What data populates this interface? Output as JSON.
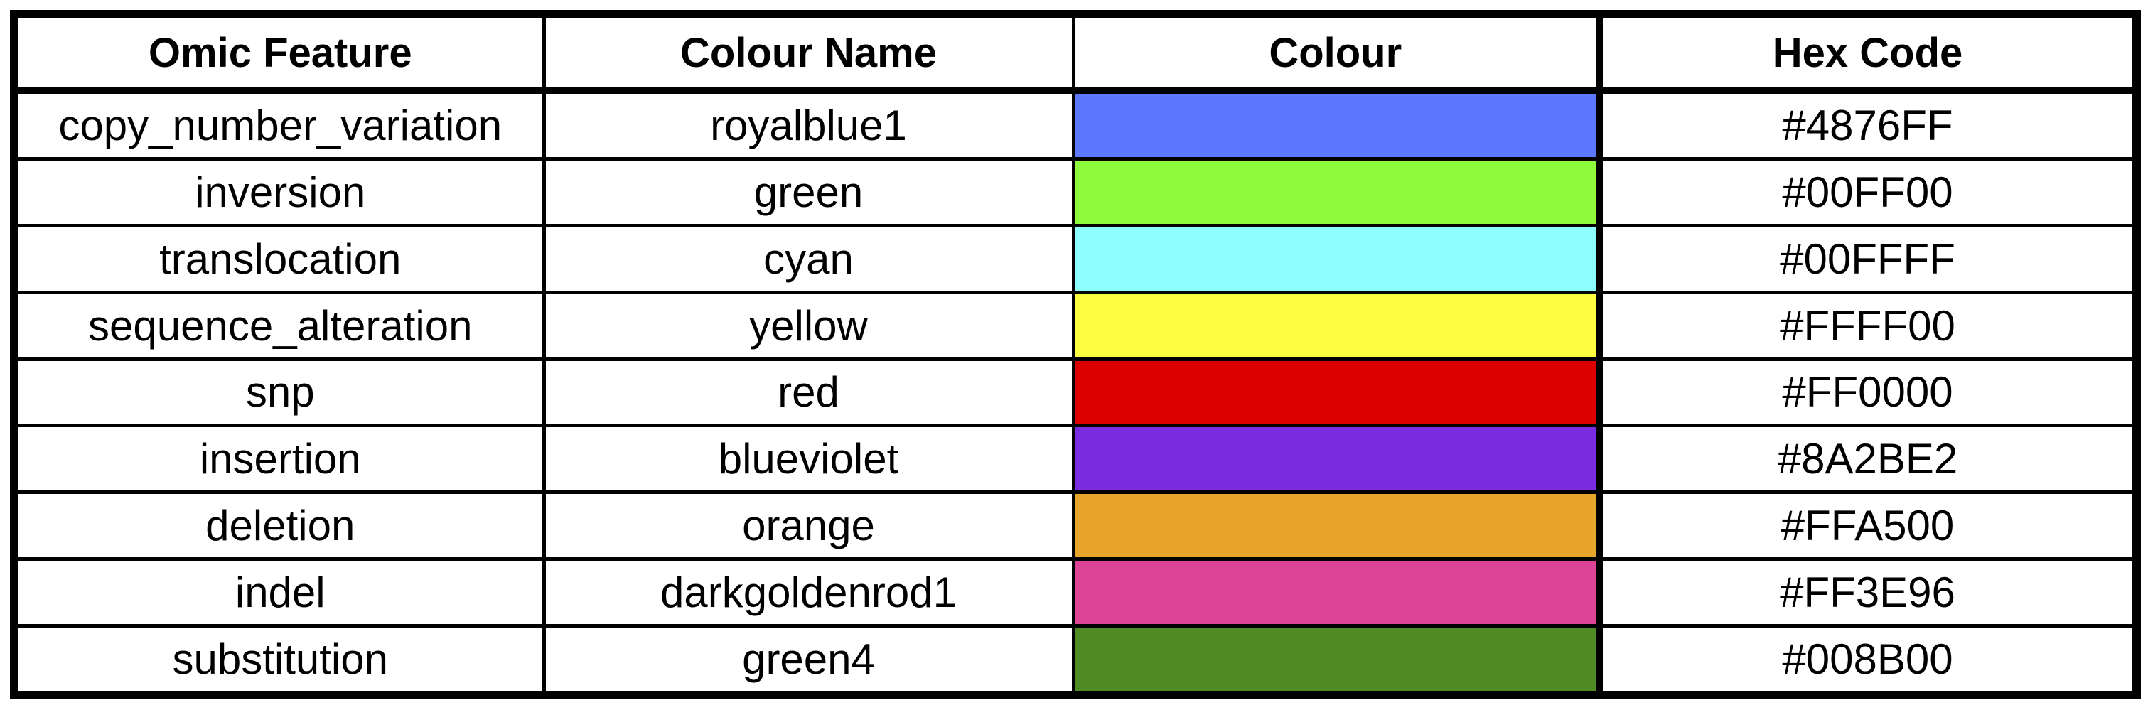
{
  "table": {
    "headers": {
      "feature": "Omic Feature",
      "colour_name": "Colour Name",
      "colour": "Colour",
      "hex": "Hex Code"
    },
    "rows": [
      {
        "feature": "copy_number_variation",
        "colour_name": "royalblue1",
        "hex": "#4876FF",
        "swatch_color": "#5b78fe"
      },
      {
        "feature": "inversion",
        "colour_name": "green",
        "hex": "#00FF00",
        "swatch_color": "#8efc3c"
      },
      {
        "feature": "translocation",
        "colour_name": "cyan",
        "hex": "#00FFFF",
        "swatch_color": "#8dfdfd"
      },
      {
        "feature": "sequence_alteration",
        "colour_name": "yellow",
        "hex": "#FFFF00",
        "swatch_color": "#fefe41"
      },
      {
        "feature": "snp",
        "colour_name": "red",
        "hex": "#FF0000",
        "swatch_color": "#dc0000"
      },
      {
        "feature": "insertion",
        "colour_name": "blueviolet",
        "hex": "#8A2BE2",
        "swatch_color": "#7a2de0"
      },
      {
        "feature": "deletion",
        "colour_name": "orange",
        "hex": "#FFA500",
        "swatch_color": "#e8a52b"
      },
      {
        "feature": "indel",
        "colour_name": "darkgoldenrod1",
        "hex": "#FF3E96",
        "swatch_color": "#de4496"
      },
      {
        "feature": "substitution",
        "colour_name": "green4",
        "hex": "#008B00",
        "swatch_color": "#4f8a23"
      }
    ]
  }
}
